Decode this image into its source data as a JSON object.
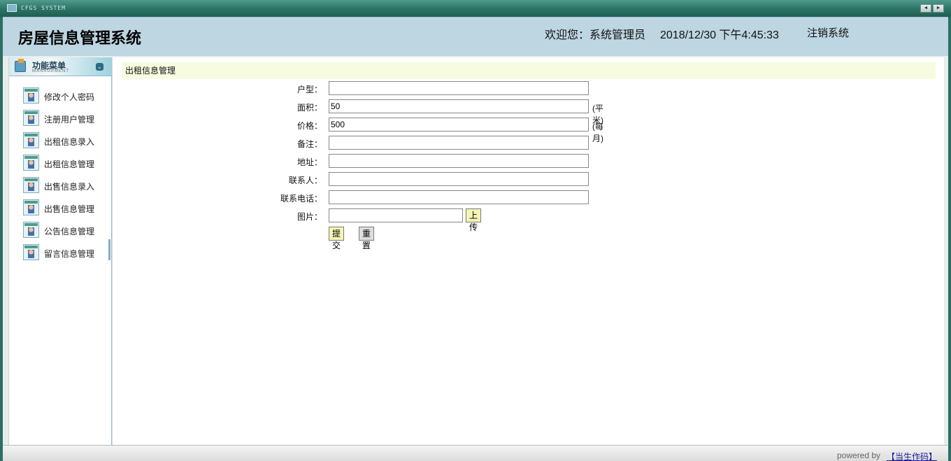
{
  "window": {
    "system_name": "CFGS SYSTEM",
    "prev_label": "◄",
    "next_label": "►"
  },
  "header": {
    "title": "房屋信息管理系统",
    "welcome": "欢迎您：系统管理员",
    "datetime": "2018/12/30 下午4:45:33",
    "logout": "注销系统"
  },
  "sidebar": {
    "title": "功能菜单",
    "subtitle": "MANAGEMENT",
    "collapse_icon": "⌄",
    "items": [
      {
        "label": "修改个人密码",
        "icon": "user-icon"
      },
      {
        "label": "注册用户管理",
        "icon": "user-icon"
      },
      {
        "label": "出租信息录入",
        "icon": "user-icon"
      },
      {
        "label": "出租信息管理",
        "icon": "user-icon"
      },
      {
        "label": "出售信息录入",
        "icon": "user-icon"
      },
      {
        "label": "出售信息管理",
        "icon": "user-icon"
      },
      {
        "label": "公告信息管理",
        "icon": "user-icon"
      },
      {
        "label": "留言信息管理",
        "icon": "user-icon"
      }
    ]
  },
  "main": {
    "page_title": "出租信息管理",
    "form": {
      "fields": [
        {
          "label": "户型：",
          "value": "",
          "unit": ""
        },
        {
          "label": "面积：",
          "value": "50",
          "unit": "(平米)"
        },
        {
          "label": "价格：",
          "value": "500",
          "unit": "(每月)"
        },
        {
          "label": "备注：",
          "value": "",
          "unit": ""
        },
        {
          "label": "地址：",
          "value": "",
          "unit": ""
        },
        {
          "label": "联系人：",
          "value": "",
          "unit": ""
        },
        {
          "label": "联系电话：",
          "value": "",
          "unit": ""
        }
      ],
      "picture_label": "图片：",
      "picture_value": "",
      "upload_label": "上传",
      "submit_label": "提交",
      "reset_label": "重置"
    }
  },
  "footer": {
    "powered": "powered by",
    "code_link": "【当生作码】"
  },
  "colors": {
    "frame": "#2e6e63",
    "header_bg": "#bdd6e1",
    "title_bar_bg": "#f7fbdf",
    "button_yellow": "#f3f5b4"
  }
}
